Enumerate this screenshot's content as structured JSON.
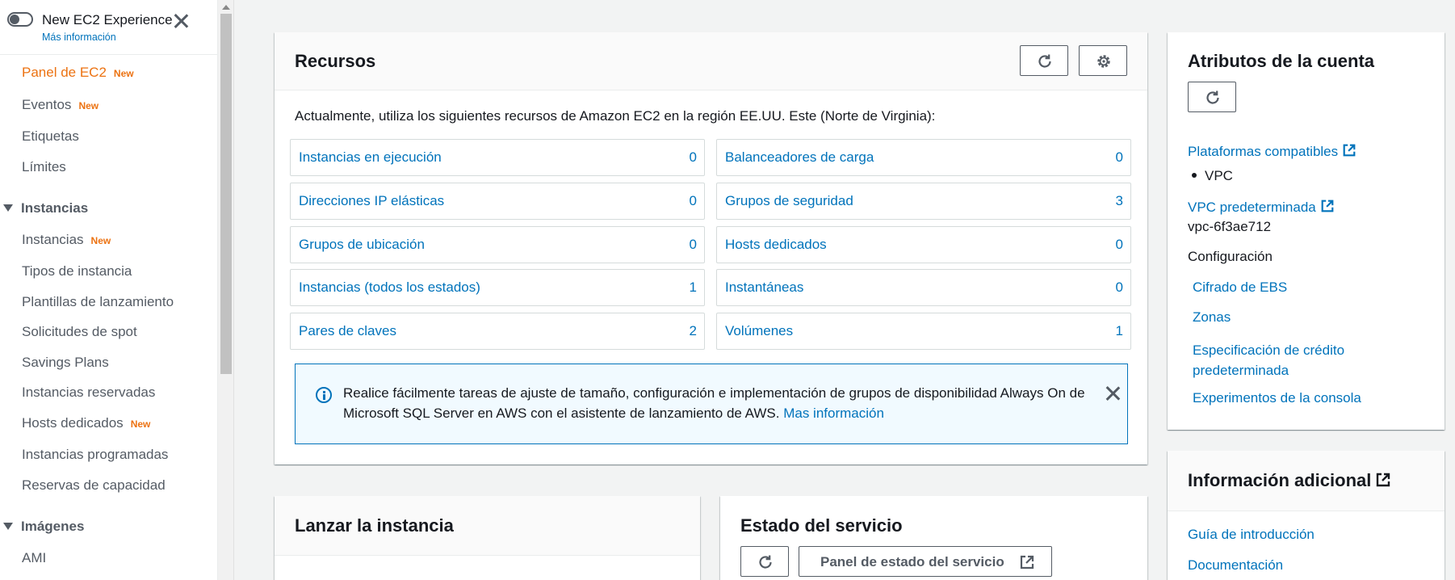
{
  "colors": {
    "accent": "#ec7211",
    "link": "#0073bb",
    "text": "#16191f",
    "muted": "#545b64",
    "info_bg": "#f1faff"
  },
  "sidebar": {
    "toggle_title": "New EC2 Experience",
    "toggle_link": "Más información",
    "toggle_state": "off",
    "items": [
      {
        "label": "Panel de EC2",
        "badge": "New",
        "active": true
      },
      {
        "label": "Eventos",
        "badge": "New"
      },
      {
        "label": "Etiquetas"
      },
      {
        "label": "Límites"
      }
    ],
    "sections": [
      {
        "title": "Instancias",
        "items": [
          {
            "label": "Instancias",
            "badge": "New"
          },
          {
            "label": "Tipos de instancia"
          },
          {
            "label": "Plantillas de lanzamiento"
          },
          {
            "label": "Solicitudes de spot"
          },
          {
            "label": "Savings Plans"
          },
          {
            "label": "Instancias reservadas"
          },
          {
            "label": "Hosts dedicados",
            "badge": "New"
          },
          {
            "label": "Instancias programadas"
          },
          {
            "label": "Reservas de capacidad"
          }
        ]
      },
      {
        "title": "Imágenes",
        "items": [
          {
            "label": "AMI"
          }
        ]
      }
    ]
  },
  "resources": {
    "title": "Recursos",
    "intro": "Actualmente, utiliza los siguientes recursos de Amazon EC2 en la región EE.UU. Este (Norte de Virginia):",
    "left": [
      {
        "label": "Instancias en ejecución",
        "count": "0"
      },
      {
        "label": "Direcciones IP elásticas",
        "count": "0"
      },
      {
        "label": "Grupos de ubicación",
        "count": "0"
      },
      {
        "label": "Instancias (todos los estados)",
        "count": "1"
      },
      {
        "label": "Pares de claves",
        "count": "2"
      }
    ],
    "right": [
      {
        "label": "Balanceadores de carga",
        "count": "0"
      },
      {
        "label": "Grupos de seguridad",
        "count": "3"
      },
      {
        "label": "Hosts dedicados",
        "count": "0"
      },
      {
        "label": "Instantáneas",
        "count": "0"
      },
      {
        "label": "Volúmenes",
        "count": "1"
      }
    ],
    "info_text": "Realice fácilmente tareas de ajuste de tamaño, configuración e implementación de grupos de disponibilidad Always On de Microsoft SQL Server en AWS con el asistente de lanzamiento de AWS.",
    "info_link": "Mas información"
  },
  "launch": {
    "title": "Lanzar la instancia"
  },
  "service_health": {
    "title": "Estado del servicio",
    "dashboard_button": "Panel de estado del servicio"
  },
  "account": {
    "title": "Atributos de la cuenta",
    "platforms_link": "Plataformas compatibles",
    "platform_value": "VPC",
    "default_vpc_link": "VPC predeterminada",
    "default_vpc_value": "vpc-6f3ae712",
    "settings_label": "Configuración",
    "settings": [
      {
        "label": "Cifrado de EBS"
      },
      {
        "label": "Zonas"
      },
      {
        "label": "Especificación de crédito predeterminada"
      },
      {
        "label": "Experimentos de la consola"
      }
    ]
  },
  "additional": {
    "title": "Información adicional",
    "links": [
      {
        "label": "Guía de introducción"
      },
      {
        "label": "Documentación"
      }
    ]
  }
}
